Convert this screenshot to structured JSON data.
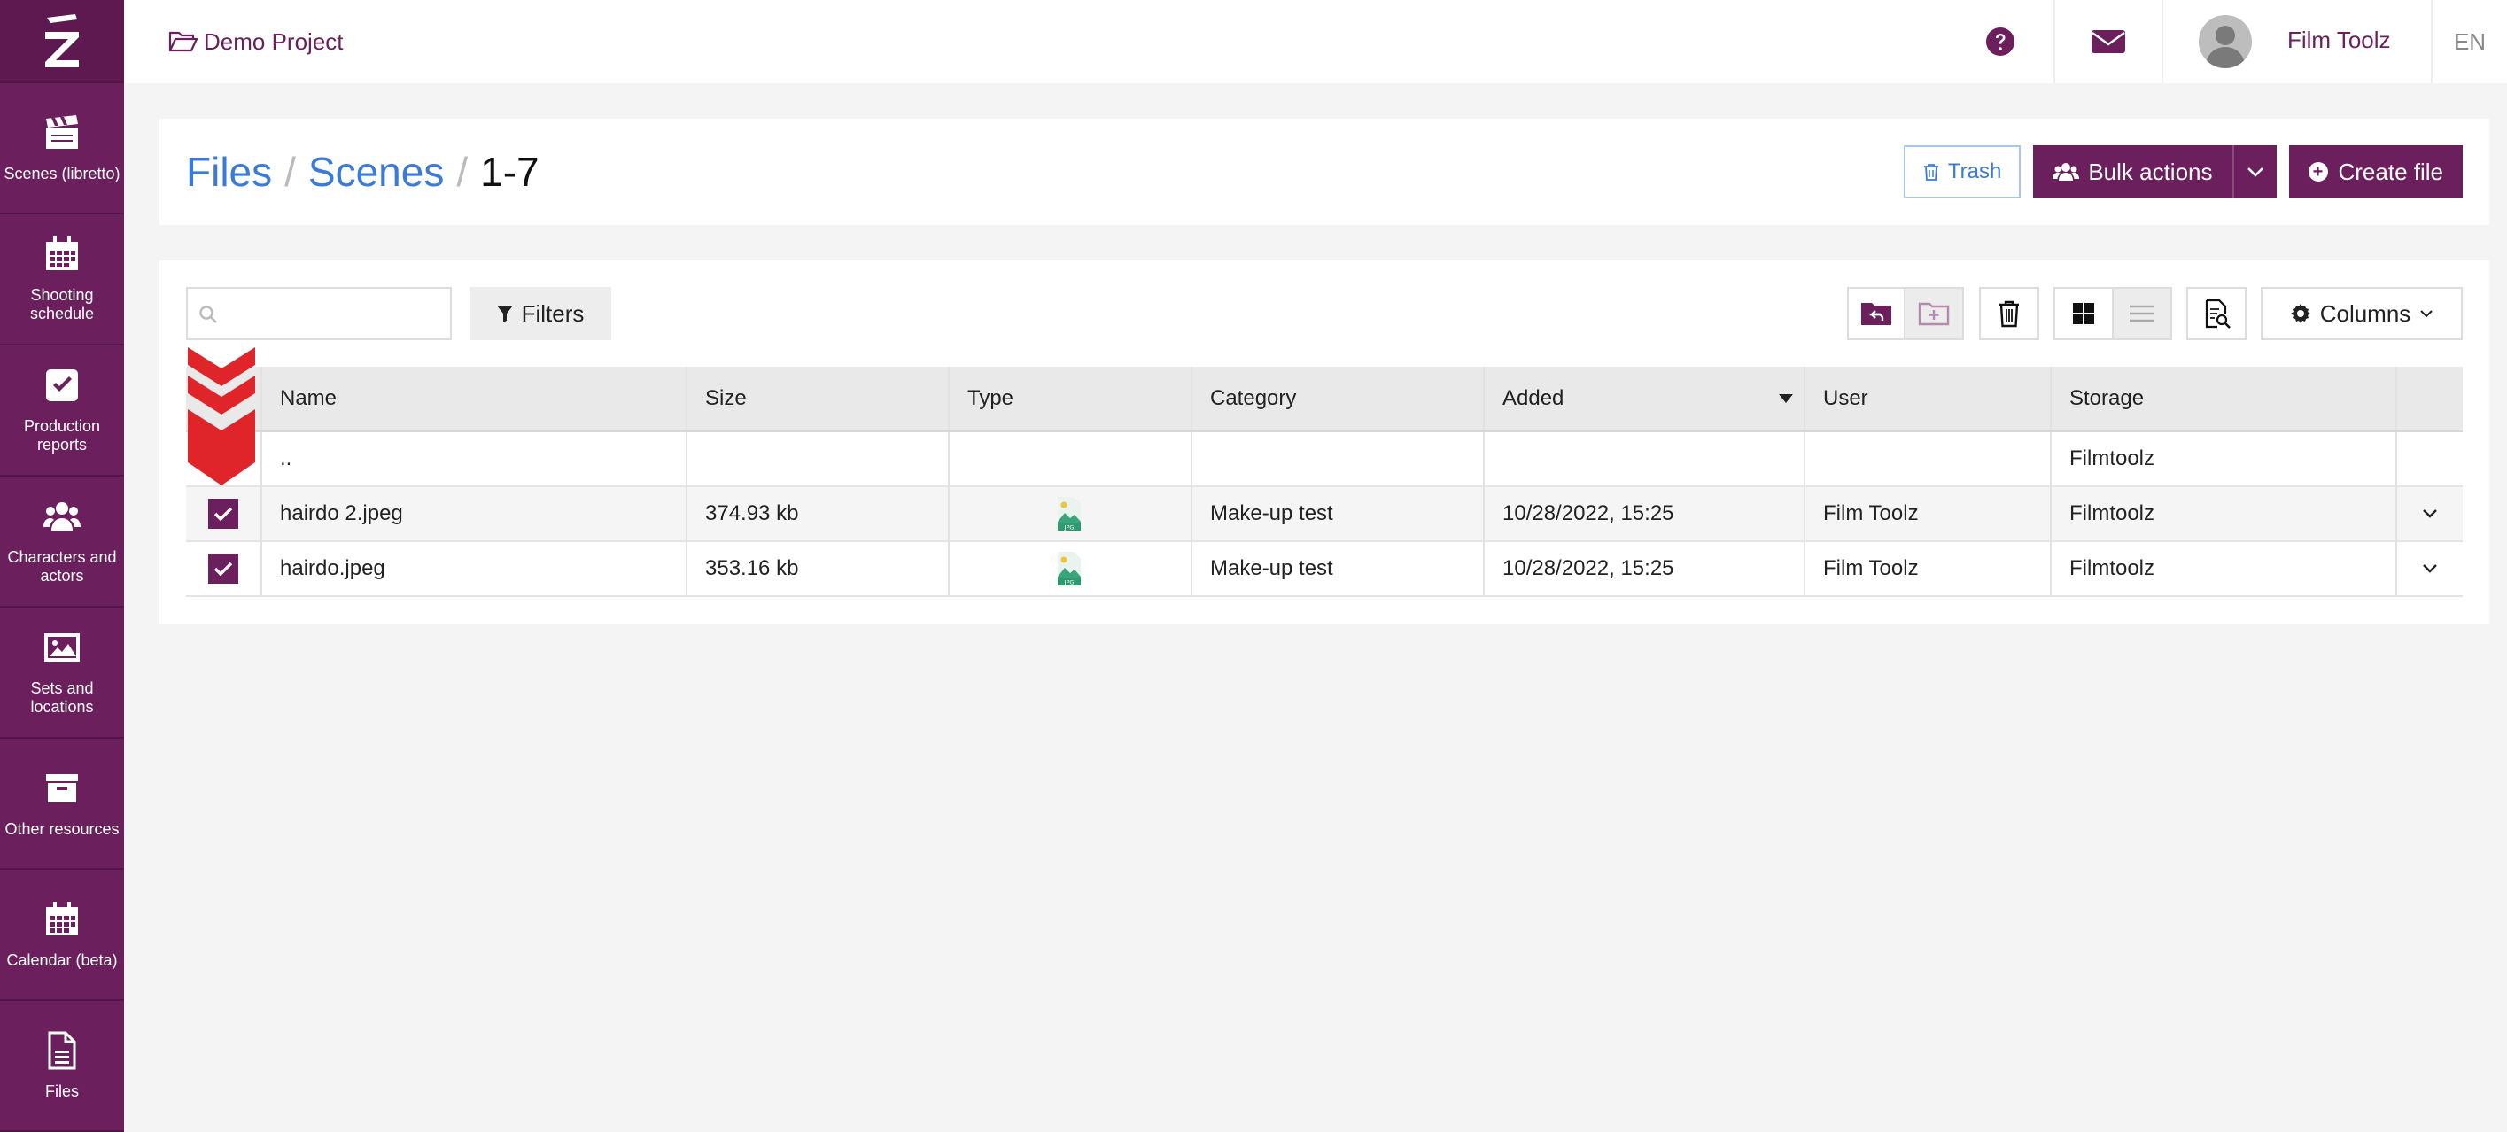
{
  "sidebar": {
    "items": [
      {
        "label": "Scenes (libretto)",
        "icon": "clapperboard-icon"
      },
      {
        "label": "Shooting schedule",
        "icon": "calendar-icon"
      },
      {
        "label": "Production reports",
        "icon": "checkbox-icon"
      },
      {
        "label": "Characters and actors",
        "icon": "users-icon"
      },
      {
        "label": "Sets and locations",
        "icon": "image-icon"
      },
      {
        "label": "Other resources",
        "icon": "archive-icon"
      },
      {
        "label": "Calendar (beta)",
        "icon": "calendar-icon"
      },
      {
        "label": "Files",
        "icon": "file-icon"
      }
    ]
  },
  "topbar": {
    "project": "Demo Project",
    "user_name": "Film Toolz",
    "language": "EN"
  },
  "header": {
    "breadcrumb": [
      "Files",
      "Scenes",
      "1-7"
    ],
    "trash_label": "Trash",
    "bulk_label": "Bulk actions",
    "create_label": "Create file"
  },
  "toolbar": {
    "search_placeholder": "",
    "filters_label": "Filters",
    "columns_label": "Columns"
  },
  "table": {
    "columns": [
      "Name",
      "Size",
      "Type",
      "Category",
      "Added",
      "User",
      "Storage"
    ],
    "sort_column": "Added",
    "parent_row": {
      "name": "..",
      "storage": "Filmtoolz"
    },
    "rows": [
      {
        "name": "hairdo 2.jpeg",
        "size": "374.93 kb",
        "type": "JPG",
        "category": "Make-up test",
        "added": "10/28/2022, 15:25",
        "user": "Film Toolz",
        "storage": "Filmtoolz",
        "checked": true
      },
      {
        "name": "hairdo.jpeg",
        "size": "353.16 kb",
        "type": "JPG",
        "category": "Make-up test",
        "added": "10/28/2022, 15:25",
        "user": "Film Toolz",
        "storage": "Filmtoolz",
        "checked": true
      }
    ]
  },
  "colors": {
    "brand": "#6b1f5c",
    "link": "#3b7ad6",
    "annotation_arrow": "#e0252a"
  }
}
